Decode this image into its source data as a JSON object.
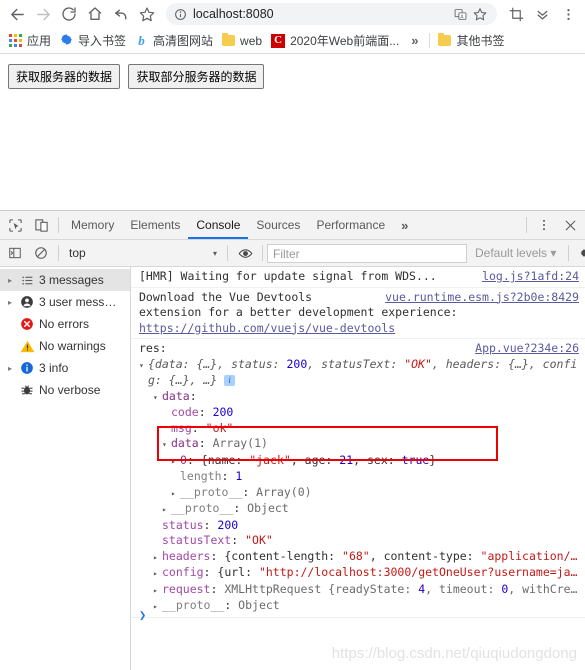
{
  "browser": {
    "nav": {
      "back": "back-arrow",
      "forward": "forward-arrow",
      "reload": "reload",
      "home": "home",
      "undo": "undo-arrow",
      "bookmark_star": "star"
    },
    "omnibox": {
      "url": "localhost:8080",
      "info_icon": "info-circle",
      "translate_icon": "translate",
      "star_icon": "star",
      "crop_icon": "crop",
      "chevrons_icon": "chevron-double-down",
      "menu_icon": "kebab-menu"
    },
    "bookmarks": [
      {
        "label": "应用",
        "icon": "apps-grid"
      },
      {
        "label": "导入书签",
        "icon": "gear"
      },
      {
        "label": "高清图网站",
        "icon": "b-logo"
      },
      {
        "label": "web",
        "icon": "folder"
      },
      {
        "label": "2020年Web前端面...",
        "icon": "c-logo"
      }
    ],
    "bookmarks_overflow": "»",
    "other_bookmarks": {
      "label": "其他书签",
      "icon": "folder"
    }
  },
  "page": {
    "buttons": [
      "获取服务器的数据",
      "获取部分服务器的数据"
    ]
  },
  "devtools": {
    "left_icons": [
      "inspect-element-icon",
      "device-toolbar-icon"
    ],
    "tabs": [
      {
        "label": "Memory",
        "active": false
      },
      {
        "label": "Elements",
        "active": false
      },
      {
        "label": "Console",
        "active": true
      },
      {
        "label": "Sources",
        "active": false
      },
      {
        "label": "Performance",
        "active": false
      }
    ],
    "tabs_overflow": "»",
    "right_icons": [
      "kebab-menu-icon",
      "close-icon"
    ],
    "filterbar": {
      "sidebar_toggle_icon": "console-sidebar-icon",
      "clear_icon": "clear-console-icon",
      "context": "top",
      "context_caret": "▾",
      "eye_icon": "live-expression-icon",
      "filter_placeholder": "Filter",
      "levels": "Default levels",
      "levels_caret": "▾",
      "settings_icon": "gear-icon"
    },
    "sidebar": [
      {
        "label": "3 messages",
        "icon": "list-icon",
        "arrow": true,
        "selected": true
      },
      {
        "label": "3 user mess…",
        "icon": "user-icon",
        "arrow": true,
        "selected": false
      },
      {
        "label": "No errors",
        "icon": "error-icon",
        "arrow": false,
        "selected": false
      },
      {
        "label": "No warnings",
        "icon": "warning-icon",
        "arrow": false,
        "selected": false
      },
      {
        "label": "3 info",
        "icon": "info-icon",
        "arrow": true,
        "selected": false
      },
      {
        "label": "No verbose",
        "icon": "bug-icon",
        "arrow": false,
        "selected": false
      }
    ],
    "console": {
      "entry1": {
        "text": "[HMR] Waiting for update signal from WDS...",
        "source": "log.js?1afd:24"
      },
      "entry2": {
        "line1": "Download the Vue Devtools",
        "line2": "extension for a better development experience:",
        "link": "https://github.com/vuejs/vue-devtools",
        "source": "vue.runtime.esm.js?2b0e:8429"
      },
      "entry3": {
        "label": "res:",
        "source": "App.vue?234e:26",
        "summary_a": "{data: {…}, status: ",
        "summary_status": "200",
        "summary_b": ", statusText: ",
        "summary_ok": "\"OK\"",
        "summary_c": ", headers: {…}, confi",
        "summary_d": "g: {…}, …}",
        "info_badge": "i",
        "rows": [
          {
            "indent": 1,
            "tri": "down",
            "key": "data",
            "keycolor": "propd",
            "sep": ":",
            "value": ""
          },
          {
            "indent": 2,
            "tri": "none",
            "key": "code",
            "keycolor": "prop",
            "sep": ": ",
            "value": "200",
            "vtype": "num"
          },
          {
            "indent": 2,
            "tri": "none",
            "key": "msg",
            "keycolor": "prop",
            "sep": ": ",
            "value": "\"ok\"",
            "vtype": "str"
          },
          {
            "indent": 2,
            "tri": "down",
            "key": "data",
            "keycolor": "propd",
            "sep": ": ",
            "value": "Array(1)",
            "vtype": "grey"
          },
          {
            "indent": 3,
            "tri": "right",
            "key": "0",
            "keycolor": "propd",
            "sep": ": ",
            "value": "{name: \"jack\", age: 21, sex: true}",
            "vtype": "objlit"
          },
          {
            "indent": 3,
            "tri": "none",
            "key": "length",
            "keycolor": "dim",
            "sep": ": ",
            "value": "1",
            "vtype": "num"
          },
          {
            "indent": 3,
            "tri": "right",
            "key": "__proto__",
            "keycolor": "dim",
            "sep": ": ",
            "value": "Array(0)",
            "vtype": "grey"
          },
          {
            "indent": 2,
            "tri": "right",
            "key": "__proto__",
            "keycolor": "dim",
            "sep": ": ",
            "value": "Object",
            "vtype": "grey"
          },
          {
            "indent": 2,
            "tri": "none",
            "key": "status",
            "keycolor": "prop",
            "sep": ": ",
            "value": "200",
            "vtype": "num"
          },
          {
            "indent": 2,
            "tri": "none",
            "key": "statusText",
            "keycolor": "prop",
            "sep": ": ",
            "value": "\"OK\"",
            "vtype": "str"
          },
          {
            "indent": 1,
            "tri": "right",
            "key": "headers",
            "keycolor": "prop",
            "sep": ": ",
            "value": "{content-length: \"68\", content-type: \"application/…",
            "vtype": "objlit2"
          },
          {
            "indent": 1,
            "tri": "right",
            "key": "config",
            "keycolor": "prop",
            "sep": ": ",
            "value": "{url: \"http://localhost:3000/getOneUser?username=ja…",
            "vtype": "objlit3"
          },
          {
            "indent": 1,
            "tri": "right",
            "key": "request",
            "keycolor": "prop",
            "sep": ": ",
            "value": "XMLHttpRequest {readyState: 4, timeout: 0, withCre…",
            "vtype": "objlit4"
          },
          {
            "indent": 1,
            "tri": "right",
            "key": "__proto__",
            "keycolor": "dim",
            "sep": ": ",
            "value": "Object",
            "vtype": "grey"
          }
        ]
      },
      "prompt_symbol": "❯",
      "highlight_color": "#ee0000"
    },
    "watermark": "https://blog.csdn.net/qiuqiudongdong"
  }
}
